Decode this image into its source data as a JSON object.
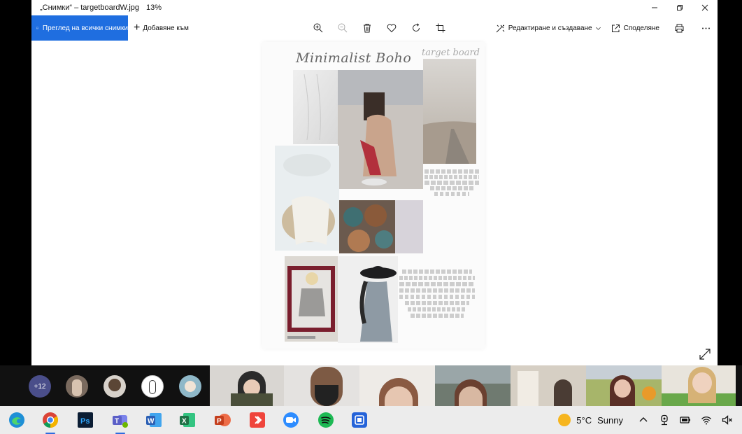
{
  "window": {
    "title": "„Снимки“ – targetboardW.jpg",
    "zoom": "13%"
  },
  "toolbar": {
    "view_all_label": "Преглед на всички снимки",
    "add_to_label": "Добавяне към",
    "edit_create_label": "Редактиране и създаване",
    "share_label": "Споделяне"
  },
  "board": {
    "title": "Minimalist Boho",
    "subtitle": "target board"
  },
  "call": {
    "overflow_count": "+12"
  },
  "taskbar": {
    "weather_temp": "5°C",
    "weather_desc": "Sunny"
  },
  "colors": {
    "accent": "#1f6ee0",
    "teams": "#5b5fc7",
    "word": "#2b5fb4",
    "excel": "#1e7145",
    "powerpoint": "#c43e1c",
    "spotify": "#1db954",
    "zoom": "#2d8cff"
  }
}
